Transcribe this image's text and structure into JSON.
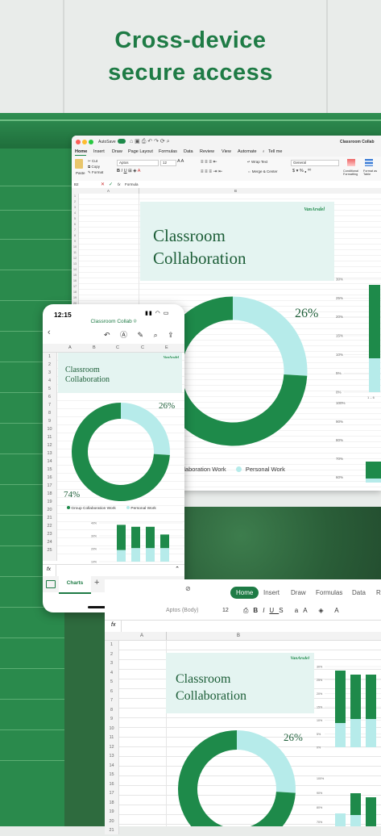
{
  "headline": {
    "line1": "Cross-device",
    "line2": "secure access"
  },
  "doc": {
    "title_line1": "Classroom",
    "title_line2": "Collaboration",
    "brand": "VanArsdel",
    "pct_personal": "26%",
    "pct_group": "74%",
    "legend_group": "Group Collaboration Work",
    "legend_group_short": "Collaboration Work",
    "legend_personal": "Personal Work",
    "colors": {
      "group": "#1e8a4a",
      "personal": "#b6ebea",
      "card": "#e4f4f1"
    }
  },
  "chart_data": [
    {
      "type": "pie",
      "labels": [
        "Group Collaboration Work",
        "Personal Work"
      ],
      "values": [
        74,
        26
      ],
      "donut": true
    },
    {
      "type": "bar",
      "stacked": true,
      "categories": [
        "1",
        "2",
        "3",
        "4"
      ],
      "series": [
        {
          "name": "Group Collaboration Work",
          "values": [
            26,
            22,
            22,
            14
          ]
        },
        {
          "name": "Personal Work",
          "values": [
            12,
            14,
            14,
            14
          ]
        }
      ]
    }
  ],
  "mac": {
    "autosave": "AutoSave",
    "window_title": "Classroom Collab",
    "menu": [
      "Home",
      "Insert",
      "Draw",
      "Page Layout",
      "Formulas",
      "Data",
      "Review",
      "View",
      "Automate",
      "Tell me"
    ],
    "font_name": "Aptos",
    "font_size": "12",
    "number_format": "General",
    "paste": "Paste",
    "cut": "Cut",
    "copy": "Copy",
    "format": "Format",
    "wrap_text": "Wrap Text",
    "merge_center": "Merge & Center",
    "cond_format": "Conditional Formatting",
    "format_table": "Format as Table",
    "cell_ref": "B2",
    "formula_fx": "fx",
    "formula_value": "Formula",
    "col_a": "A",
    "col_b": "B",
    "rows": [
      "1",
      "2",
      "3",
      "4",
      "5",
      "6",
      "7",
      "8",
      "9",
      "10",
      "11",
      "12",
      "13",
      "14",
      "15",
      "16",
      "17",
      "18",
      "19",
      "20",
      "21",
      "22",
      "23",
      "24",
      "25",
      "26",
      "27",
      "28",
      "29",
      "30",
      "31",
      "32",
      "33",
      "34",
      "35",
      "36",
      "37",
      "38",
      "39",
      "40",
      "41",
      "42",
      "43",
      "44",
      "45",
      "46",
      "47",
      "48",
      "49",
      "50",
      "51",
      "52"
    ],
    "bar_ticks_top": [
      "30%",
      "25%",
      "20%",
      "15%",
      "10%",
      "5%",
      "0%"
    ],
    "bar_ticks_bottom": [
      "100%",
      "90%",
      "80%",
      "70%",
      "60%",
      "0%"
    ],
    "bar_cat": "1 – 6"
  },
  "phone": {
    "time": "12:15",
    "title": "Classroom Collab",
    "cols": [
      "A",
      "B",
      "C",
      "C",
      "E"
    ],
    "rows": [
      "1",
      "2",
      "3",
      "4",
      "5",
      "6",
      "7",
      "8",
      "9",
      "10",
      "11",
      "12",
      "13",
      "14",
      "15",
      "16",
      "17",
      "18",
      "19",
      "20",
      "21",
      "22",
      "23",
      "24",
      "25"
    ],
    "fx": "fx",
    "sheet_tab": "Charts",
    "add": "+",
    "bar_ticks": [
      "40%",
      "30%",
      "20%",
      "10%"
    ]
  },
  "tablet": {
    "tabs": [
      "Home",
      "Insert",
      "Draw",
      "Formulas",
      "Data",
      "Re"
    ],
    "font": "Aptos (Body)",
    "size": "12",
    "fx": "fx",
    "col_a": "A",
    "col_b": "B",
    "rows": [
      "1",
      "2",
      "3",
      "4",
      "5",
      "6",
      "7",
      "8",
      "9",
      "10",
      "11",
      "12",
      "13",
      "14",
      "15",
      "16",
      "17",
      "18",
      "19",
      "20",
      "21"
    ],
    "bar_ticks": [
      "30%",
      "25%",
      "20%",
      "15%",
      "10%",
      "5%",
      "0%"
    ],
    "bar_ticks2": [
      "100%",
      "90%",
      "80%",
      "70%"
    ]
  }
}
